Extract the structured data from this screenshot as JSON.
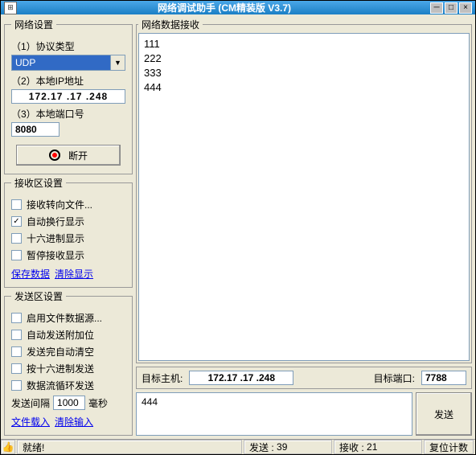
{
  "window": {
    "title": "网络调试助手  (CM精装版  V3.7)"
  },
  "network": {
    "legend": "网络设置",
    "protocol_label": "（1）协议类型",
    "protocol_value": "UDP",
    "local_ip_label": "（2）本地IP地址",
    "local_ip_value": "172.17 .17 .248",
    "local_port_label": "（3）本地端口号",
    "local_port_value": "8080",
    "disconnect_label": "断开"
  },
  "recv_settings": {
    "legend": "接收区设置",
    "to_file": "接收转向文件...",
    "auto_wrap": "自动换行显示",
    "hex": "十六进制显示",
    "pause": "暂停接收显示",
    "save_link": "保存数据",
    "clear_link": "清除显示",
    "auto_wrap_checked": true
  },
  "send_settings": {
    "legend": "发送区设置",
    "file_src": "启用文件数据源...",
    "auto_bit": "自动发送附加位",
    "auto_clear": "发送完自动清空",
    "hex_send": "按十六进制发送",
    "loop_send": "数据流循环发送",
    "interval_label": "发送间隔",
    "interval_value": "1000",
    "interval_unit": "毫秒",
    "load_link": "文件载入",
    "clear_link": "清除输入"
  },
  "recv_area": {
    "legend": "网络数据接收",
    "lines": [
      "111",
      "222",
      "333",
      "444"
    ]
  },
  "target": {
    "host_label": "目标主机:",
    "host_value": "172.17 .17 .248",
    "port_label": "目标端口:",
    "port_value": "7788"
  },
  "send": {
    "text": "444",
    "button": "发送"
  },
  "status": {
    "ready": "就绪!",
    "send_label": "发送 :",
    "send_count": "39",
    "recv_label": "接收 :",
    "recv_count": "21",
    "reset": "复位计数"
  }
}
